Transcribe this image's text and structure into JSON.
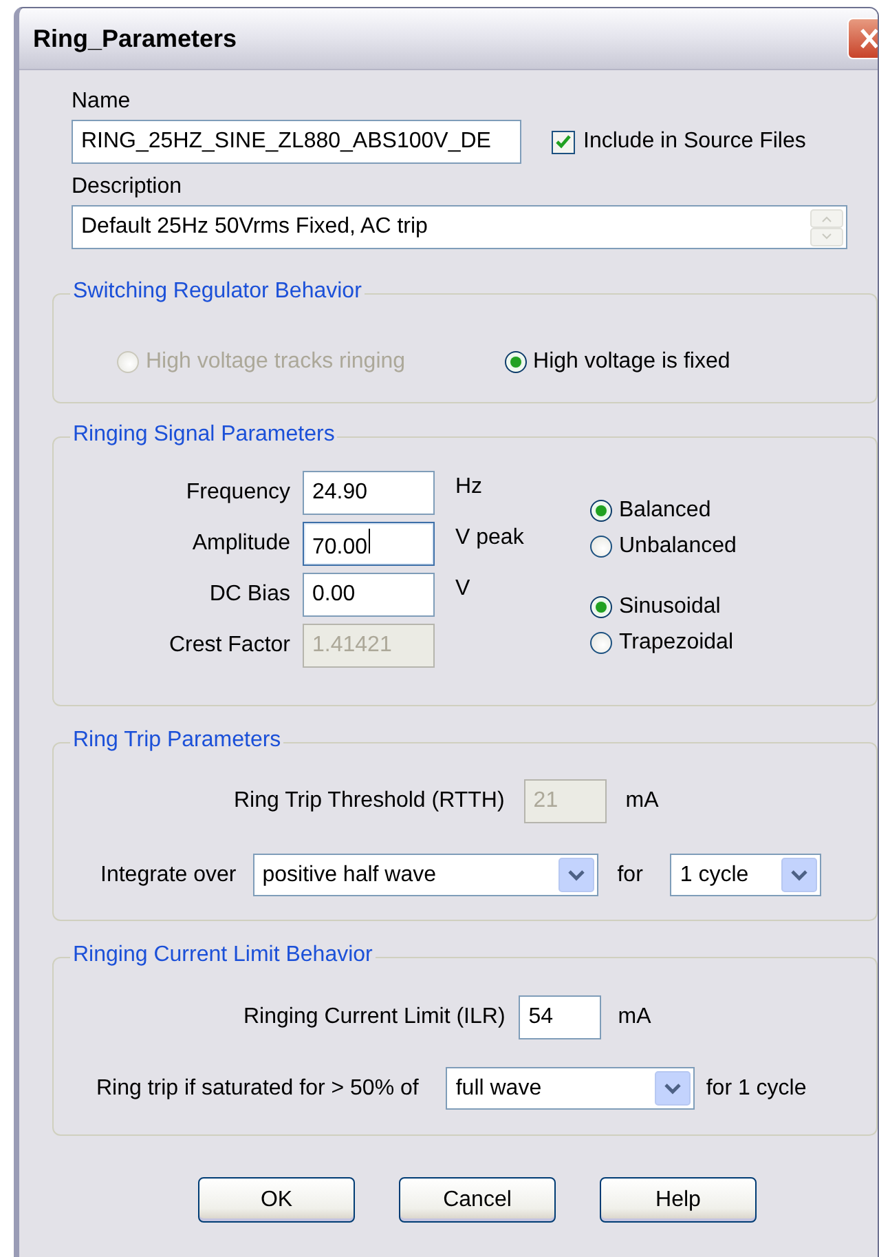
{
  "window": {
    "title": "Ring_Parameters"
  },
  "name": {
    "label": "Name",
    "value": "RING_25HZ_SINE_ZL880_ABS100V_DE"
  },
  "include_in_source": {
    "label": "Include in Source Files",
    "checked": true
  },
  "description": {
    "label": "Description",
    "value": "Default 25Hz 50Vrms Fixed, AC trip"
  },
  "switching_regulator": {
    "title": "Switching Regulator Behavior",
    "options": [
      {
        "label": "High voltage tracks ringing",
        "selected": false,
        "disabled": true
      },
      {
        "label": "High voltage is fixed",
        "selected": true,
        "disabled": false
      }
    ]
  },
  "ringing_signal": {
    "title": "Ringing Signal Parameters",
    "fields": [
      {
        "label": "Frequency",
        "value": "24.90",
        "unit": "Hz",
        "disabled": false,
        "focused": false
      },
      {
        "label": "Amplitude",
        "value": "70.00",
        "unit": "V peak",
        "disabled": false,
        "focused": true
      },
      {
        "label": "DC Bias",
        "value": "0.00",
        "unit": "V",
        "disabled": false,
        "focused": false
      },
      {
        "label": "Crest Factor",
        "value": "1.41421",
        "disabled": true,
        "focused": false
      }
    ],
    "balance": [
      {
        "label": "Balanced",
        "selected": true
      },
      {
        "label": "Unbalanced",
        "selected": false
      }
    ],
    "waveform": [
      {
        "label": "Sinusoidal",
        "selected": true
      },
      {
        "label": "Trapezoidal",
        "selected": false
      }
    ]
  },
  "ring_trip": {
    "title": "Ring Trip Parameters",
    "threshold": {
      "label": "Ring Trip Threshold (RTTH)",
      "value": "21",
      "unit": "mA",
      "disabled": true
    },
    "integrate": {
      "label": "Integrate over",
      "value": "positive half wave",
      "for_label": "for",
      "period": "1 cycle"
    }
  },
  "current_limit": {
    "title": "Ringing Current Limit Behavior",
    "limit": {
      "label": "Ringing Current Limit (ILR)",
      "value": "54",
      "unit": "mA",
      "disabled": false
    },
    "saturation": {
      "label": "Ring trip if saturated for > 50% of",
      "value": "full wave",
      "suffix": "for 1 cycle"
    }
  },
  "buttons": [
    {
      "label": "OK"
    },
    {
      "label": "Cancel"
    },
    {
      "label": "Help"
    }
  ]
}
